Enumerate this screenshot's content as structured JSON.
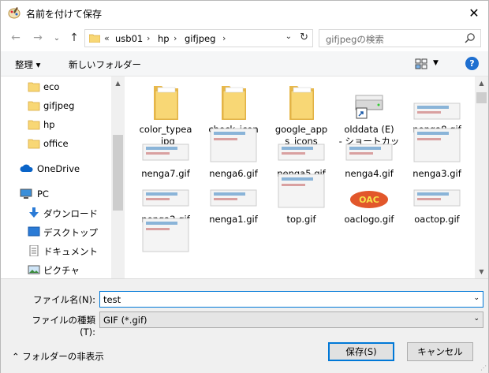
{
  "window": {
    "title": "名前を付けて保存",
    "close_label": "✕"
  },
  "nav": {
    "back": "←",
    "forward": "→",
    "recent": "⌄",
    "up": "↑",
    "breadcrumb_prefix": "«",
    "crumbs": [
      "usb01",
      "hp",
      "gifjpeg"
    ],
    "search_placeholder": "gifjpegの検索"
  },
  "toolbar": {
    "organize": "整理 ▾",
    "new_folder": "新しいフォルダー",
    "view_dd": "▼",
    "help": "?"
  },
  "sidebar": {
    "items": [
      {
        "label": "eco",
        "icon": "folder-icon"
      },
      {
        "label": "gifjpeg",
        "icon": "folder-icon"
      },
      {
        "label": "hp",
        "icon": "folder-icon"
      },
      {
        "label": "office",
        "icon": "folder-icon"
      },
      {
        "label": "OneDrive",
        "icon": "cloud-icon"
      },
      {
        "label": "PC",
        "icon": "computer-icon"
      },
      {
        "label": "ダウンロード",
        "icon": "download-icon"
      },
      {
        "label": "デスクトップ",
        "icon": "desktop-icon"
      },
      {
        "label": "ドキュメント",
        "icon": "document-icon"
      },
      {
        "label": "ピクチャ",
        "icon": "pictures-icon"
      }
    ]
  },
  "files": [
    {
      "name": "color_typea\n_jpg",
      "type": "folder"
    },
    {
      "name": "check_icon\n_w",
      "type": "folder"
    },
    {
      "name": "google_app\ns_icons",
      "type": "folder"
    },
    {
      "name": "olddata (E)\n- ショートカット",
      "type": "shortcut"
    },
    {
      "name": "nenga8.gif",
      "type": "image"
    },
    {
      "name": "nenga7.gif",
      "type": "image"
    },
    {
      "name": "nenga6.gif",
      "type": "image"
    },
    {
      "name": "nenga5.gif",
      "type": "image"
    },
    {
      "name": "nenga4.gif",
      "type": "image"
    },
    {
      "name": "nenga3.gif",
      "type": "image"
    },
    {
      "name": "nenga2.gif",
      "type": "image"
    },
    {
      "name": "nenga1.gif",
      "type": "image"
    },
    {
      "name": "top.gif",
      "type": "image"
    },
    {
      "name": "oaclogo.gif",
      "type": "logo"
    },
    {
      "name": "oactop.gif",
      "type": "image"
    },
    {
      "name": "",
      "type": "image"
    }
  ],
  "form": {
    "filename_label": "ファイル名(N):",
    "filename_value": "test",
    "filetype_label": "ファイルの種類(T):",
    "filetype_value": "GIF (*.gif)",
    "hide_folders": "フォルダーの非表示",
    "save": "保存(S)",
    "cancel": "キャンセル"
  },
  "colors": {
    "accent": "#0078d7",
    "folder": "#f8d775",
    "help": "#1e6fd0"
  }
}
